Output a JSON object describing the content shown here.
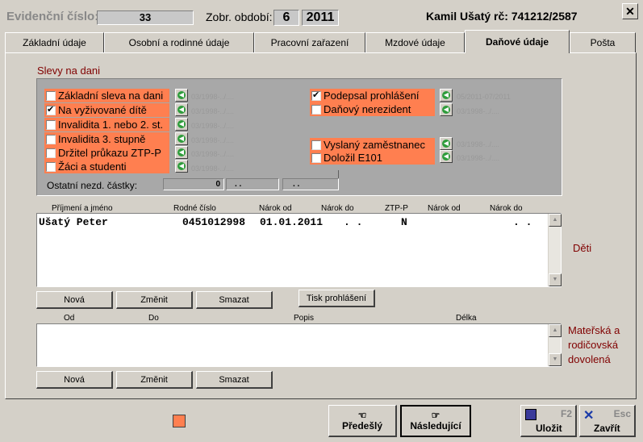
{
  "header": {
    "evid_label": "Evidenční číslo:",
    "evid_value": "33",
    "period_label": "Zobr. období:",
    "period_month": "6",
    "period_year": "2011",
    "person": "Kamil Ušatý rč: 741212/2587",
    "close_glyph": "✕"
  },
  "tabs": [
    "Základní údaje",
    "Osobní a rodinné údaje",
    "Pracovní zařazení",
    "Mzdové údaje",
    "Daňové údaje",
    "Pošta"
  ],
  "active_tab": 4,
  "discounts": {
    "title": "Slevy na dani",
    "left": [
      {
        "label": "Základní sleva na dani",
        "checked": false,
        "date": "03/1998-../...."
      },
      {
        "label": "Na vyživované dítě",
        "checked": true,
        "date": "03/1998-../...."
      },
      {
        "label": "Invalidita 1. nebo 2. st.",
        "checked": false,
        "date": "03/1998-../...."
      },
      {
        "label": "Invalidita 3. stupně",
        "checked": false,
        "date": "03/1998-../...."
      },
      {
        "label": "Držitel průkazu ZTP-P",
        "checked": false,
        "date": "03/1998-../...."
      },
      {
        "label": "Žáci a studenti",
        "checked": false,
        "date": "03/1998-../...."
      }
    ],
    "right_top": [
      {
        "label": "Podepsal prohlášení",
        "checked": true,
        "date": "05/2011-07/2011"
      },
      {
        "label": "Daňový nerezident",
        "checked": false,
        "date": "03/1998-../...."
      }
    ],
    "right_bottom": [
      {
        "label": "Vyslaný zaměstnanec",
        "checked": false,
        "date": "03/1998-../...."
      },
      {
        "label": "Doložil E101",
        "checked": false,
        "date": "03/1998-../...."
      }
    ],
    "other_label": "Ostatní nezd. částky:",
    "other_value": "0",
    "other_from": ". .",
    "other_to": ". ."
  },
  "children": {
    "side_label": "Děti",
    "columns": [
      "Příjmení a jméno",
      "Rodné číslo",
      "Nárok od",
      "Nárok do",
      "ZTP-P",
      "Nárok od",
      "Nárok do"
    ],
    "rows": [
      {
        "name": "Ušatý Peter",
        "rc": "0451012998",
        "od": "01.01.2011",
        "do": ". .",
        "ztp": "N",
        "od2": "",
        "do2": ". ."
      }
    ],
    "buttons": {
      "new": "Nová",
      "edit": "Změnit",
      "delete": "Smazat",
      "print": "Tisk prohlášení"
    }
  },
  "maternity": {
    "side_label": "Mateřská a rodičovská dovolená",
    "columns": [
      "Od",
      "Do",
      "Popis",
      "Délka"
    ],
    "buttons": {
      "new": "Nová",
      "edit": "Změnit",
      "delete": "Smazat"
    }
  },
  "footer": {
    "prev": "Předešlý",
    "next": "Následující",
    "save": "Uložit",
    "save_key": "F2",
    "close": "Zavřít",
    "close_key": "Esc"
  },
  "colors": {
    "accent": "#ff7f50",
    "maroon": "#800000",
    "panel": "#a8a8a8"
  }
}
